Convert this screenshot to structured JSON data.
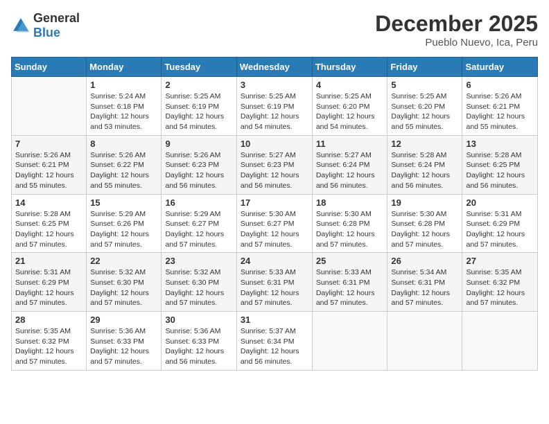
{
  "header": {
    "logo_general": "General",
    "logo_blue": "Blue",
    "month": "December 2025",
    "location": "Pueblo Nuevo, Ica, Peru"
  },
  "weekdays": [
    "Sunday",
    "Monday",
    "Tuesday",
    "Wednesday",
    "Thursday",
    "Friday",
    "Saturday"
  ],
  "weeks": [
    [
      {
        "day": "",
        "info": ""
      },
      {
        "day": "1",
        "info": "Sunrise: 5:24 AM\nSunset: 6:18 PM\nDaylight: 12 hours\nand 53 minutes."
      },
      {
        "day": "2",
        "info": "Sunrise: 5:25 AM\nSunset: 6:19 PM\nDaylight: 12 hours\nand 54 minutes."
      },
      {
        "day": "3",
        "info": "Sunrise: 5:25 AM\nSunset: 6:19 PM\nDaylight: 12 hours\nand 54 minutes."
      },
      {
        "day": "4",
        "info": "Sunrise: 5:25 AM\nSunset: 6:20 PM\nDaylight: 12 hours\nand 54 minutes."
      },
      {
        "day": "5",
        "info": "Sunrise: 5:25 AM\nSunset: 6:20 PM\nDaylight: 12 hours\nand 55 minutes."
      },
      {
        "day": "6",
        "info": "Sunrise: 5:26 AM\nSunset: 6:21 PM\nDaylight: 12 hours\nand 55 minutes."
      }
    ],
    [
      {
        "day": "7",
        "info": "Sunrise: 5:26 AM\nSunset: 6:21 PM\nDaylight: 12 hours\nand 55 minutes."
      },
      {
        "day": "8",
        "info": "Sunrise: 5:26 AM\nSunset: 6:22 PM\nDaylight: 12 hours\nand 55 minutes."
      },
      {
        "day": "9",
        "info": "Sunrise: 5:26 AM\nSunset: 6:23 PM\nDaylight: 12 hours\nand 56 minutes."
      },
      {
        "day": "10",
        "info": "Sunrise: 5:27 AM\nSunset: 6:23 PM\nDaylight: 12 hours\nand 56 minutes."
      },
      {
        "day": "11",
        "info": "Sunrise: 5:27 AM\nSunset: 6:24 PM\nDaylight: 12 hours\nand 56 minutes."
      },
      {
        "day": "12",
        "info": "Sunrise: 5:28 AM\nSunset: 6:24 PM\nDaylight: 12 hours\nand 56 minutes."
      },
      {
        "day": "13",
        "info": "Sunrise: 5:28 AM\nSunset: 6:25 PM\nDaylight: 12 hours\nand 56 minutes."
      }
    ],
    [
      {
        "day": "14",
        "info": "Sunrise: 5:28 AM\nSunset: 6:25 PM\nDaylight: 12 hours\nand 57 minutes."
      },
      {
        "day": "15",
        "info": "Sunrise: 5:29 AM\nSunset: 6:26 PM\nDaylight: 12 hours\nand 57 minutes."
      },
      {
        "day": "16",
        "info": "Sunrise: 5:29 AM\nSunset: 6:27 PM\nDaylight: 12 hours\nand 57 minutes."
      },
      {
        "day": "17",
        "info": "Sunrise: 5:30 AM\nSunset: 6:27 PM\nDaylight: 12 hours\nand 57 minutes."
      },
      {
        "day": "18",
        "info": "Sunrise: 5:30 AM\nSunset: 6:28 PM\nDaylight: 12 hours\nand 57 minutes."
      },
      {
        "day": "19",
        "info": "Sunrise: 5:30 AM\nSunset: 6:28 PM\nDaylight: 12 hours\nand 57 minutes."
      },
      {
        "day": "20",
        "info": "Sunrise: 5:31 AM\nSunset: 6:29 PM\nDaylight: 12 hours\nand 57 minutes."
      }
    ],
    [
      {
        "day": "21",
        "info": "Sunrise: 5:31 AM\nSunset: 6:29 PM\nDaylight: 12 hours\nand 57 minutes."
      },
      {
        "day": "22",
        "info": "Sunrise: 5:32 AM\nSunset: 6:30 PM\nDaylight: 12 hours\nand 57 minutes."
      },
      {
        "day": "23",
        "info": "Sunrise: 5:32 AM\nSunset: 6:30 PM\nDaylight: 12 hours\nand 57 minutes."
      },
      {
        "day": "24",
        "info": "Sunrise: 5:33 AM\nSunset: 6:31 PM\nDaylight: 12 hours\nand 57 minutes."
      },
      {
        "day": "25",
        "info": "Sunrise: 5:33 AM\nSunset: 6:31 PM\nDaylight: 12 hours\nand 57 minutes."
      },
      {
        "day": "26",
        "info": "Sunrise: 5:34 AM\nSunset: 6:31 PM\nDaylight: 12 hours\nand 57 minutes."
      },
      {
        "day": "27",
        "info": "Sunrise: 5:35 AM\nSunset: 6:32 PM\nDaylight: 12 hours\nand 57 minutes."
      }
    ],
    [
      {
        "day": "28",
        "info": "Sunrise: 5:35 AM\nSunset: 6:32 PM\nDaylight: 12 hours\nand 57 minutes."
      },
      {
        "day": "29",
        "info": "Sunrise: 5:36 AM\nSunset: 6:33 PM\nDaylight: 12 hours\nand 57 minutes."
      },
      {
        "day": "30",
        "info": "Sunrise: 5:36 AM\nSunset: 6:33 PM\nDaylight: 12 hours\nand 56 minutes."
      },
      {
        "day": "31",
        "info": "Sunrise: 5:37 AM\nSunset: 6:34 PM\nDaylight: 12 hours\nand 56 minutes."
      },
      {
        "day": "",
        "info": ""
      },
      {
        "day": "",
        "info": ""
      },
      {
        "day": "",
        "info": ""
      }
    ]
  ]
}
